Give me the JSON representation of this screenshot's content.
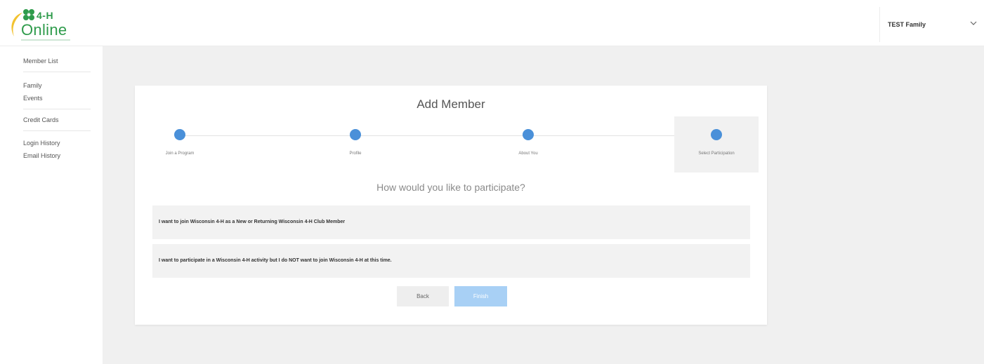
{
  "header": {
    "logo_text_top": "4-H",
    "logo_text_bottom": "Online",
    "user_name": "TEST Family",
    "brand_color": "#2e9b4b"
  },
  "sidebar": {
    "groups": [
      {
        "items": [
          {
            "label": "Member List"
          }
        ]
      },
      {
        "items": [
          {
            "label": "Family"
          },
          {
            "label": "Events"
          }
        ]
      },
      {
        "items": [
          {
            "label": "Credit Cards"
          }
        ]
      },
      {
        "items": [
          {
            "label": "Login History"
          },
          {
            "label": "Email History"
          }
        ]
      }
    ]
  },
  "wizard": {
    "title": "Add Member",
    "steps": [
      {
        "label": "Join a Program"
      },
      {
        "label": "Profile"
      },
      {
        "label": "About You"
      },
      {
        "label": "Select Participation",
        "active": true
      }
    ],
    "question": "How would you like to participate?",
    "options": [
      "I want to join Wisconsin 4-H as a New or Returning Wisconsin 4-H Club Member",
      "I want to participate in a Wisconsin 4-H activity but I do NOT want to join Wisconsin 4-H at this time."
    ],
    "back_label": "Back",
    "finish_label": "Finish",
    "accent_color": "#4a90d9"
  }
}
